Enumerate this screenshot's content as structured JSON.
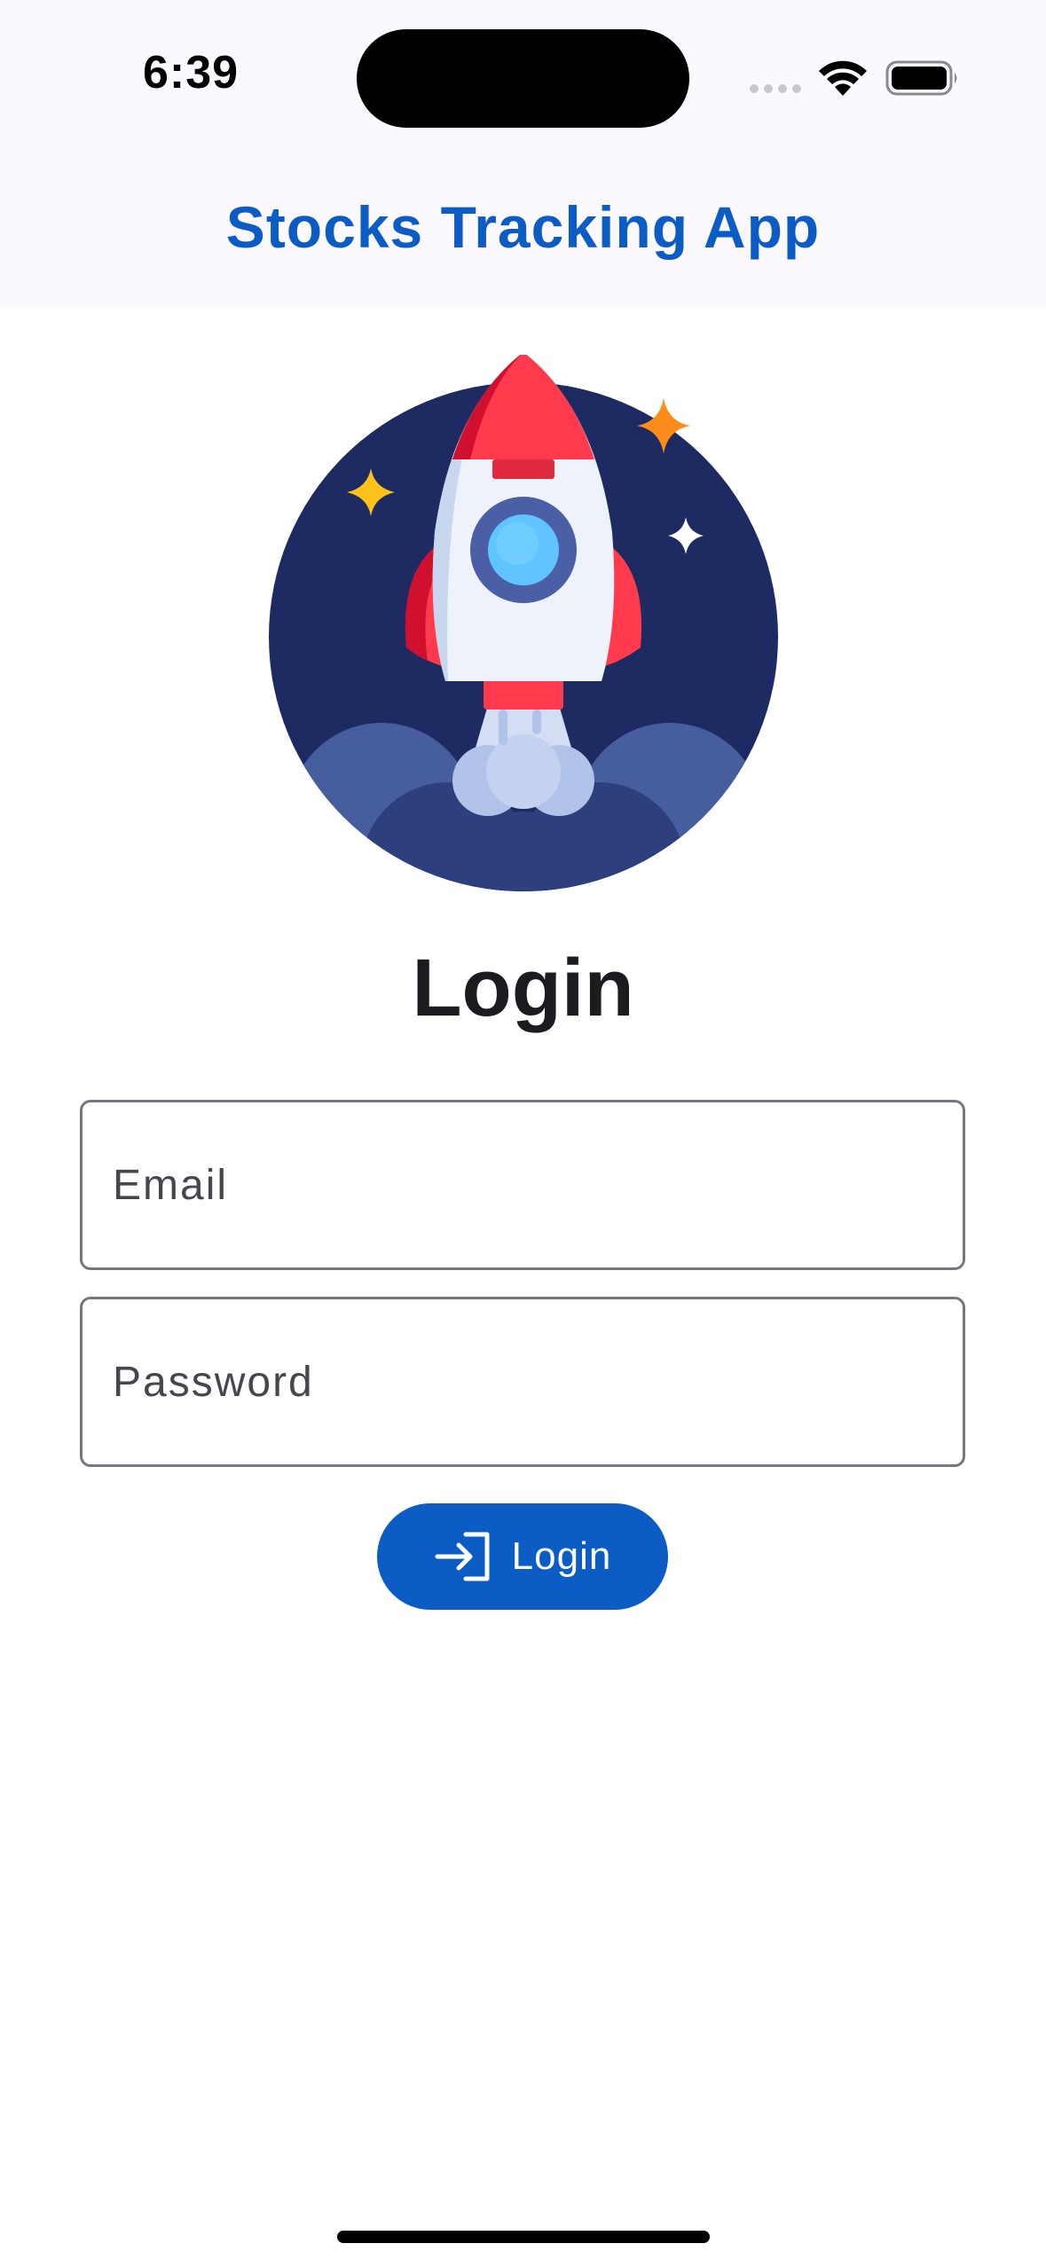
{
  "status_bar": {
    "time": "6:39",
    "wifi_icon": "wifi-icon",
    "battery_icon": "battery-icon"
  },
  "header": {
    "title": "Stocks Tracking App"
  },
  "illustration": {
    "icon": "rocket-launch-icon"
  },
  "form": {
    "heading": "Login",
    "email_placeholder": "Email",
    "email_value": "",
    "password_placeholder": "Password",
    "password_value": "",
    "login_button_label": "Login",
    "login_button_icon": "login-arrow-icon"
  },
  "colors": {
    "accent": "#0B5CC4",
    "header_background": "#FBF9FD",
    "field_border": "#79747E"
  }
}
